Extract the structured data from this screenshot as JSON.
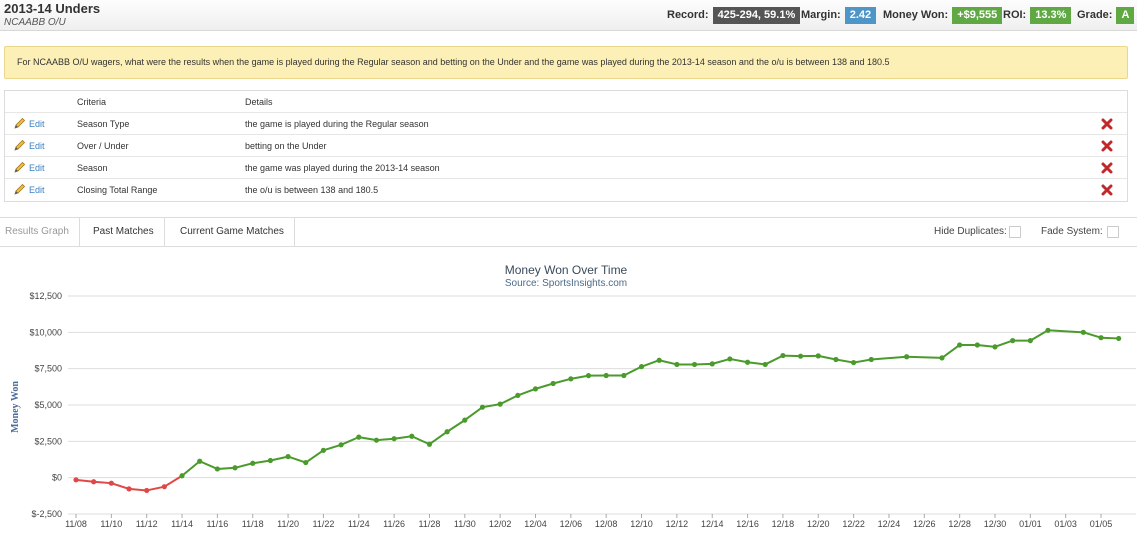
{
  "header": {
    "title": "2013-14 Unders",
    "subtitle": "NCAABB O/U",
    "record_label": "Record:",
    "record_value": "425-294, 59.1%",
    "margin_label": "Margin:",
    "margin_value": "2.42",
    "money_label": "Money Won:",
    "money_value": "+$9,555",
    "roi_label": "ROI:",
    "roi_value": "13.3%",
    "grade_label": "Grade:",
    "grade_value": "A"
  },
  "alert": {
    "text": "For NCAABB O/U wagers, what were the results when the game is played during the Regular season and betting on the Under and the game was played during the 2013-14 season and the o/u is between 138 and 180.5"
  },
  "criteria": {
    "col_criteria": "Criteria",
    "col_details": "Details",
    "edit_label": "Edit",
    "rows": [
      {
        "criteria": "Season Type",
        "details": "the game is played during the Regular season"
      },
      {
        "criteria": "Over / Under",
        "details": "betting on the Under"
      },
      {
        "criteria": "Season",
        "details": "the game was played during the 2013-14 season"
      },
      {
        "criteria": "Closing Total Range",
        "details": "the o/u is between 138 and 180.5"
      }
    ]
  },
  "tabs": {
    "results_graph": "Results Graph",
    "past_matches": "Past Matches",
    "current_game_matches": "Current Game Matches",
    "hide_duplicates": "Hide Duplicates:",
    "fade_system": "Fade System:"
  },
  "colors": {
    "positive": "#4a9a2c",
    "negative": "#e04848",
    "grid": "#dddddd"
  },
  "chart_data": {
    "type": "line",
    "title": "Money Won Over Time",
    "subtitle": "Source: SportsInsights.com",
    "ylabel": "Money Won",
    "xlabel": "",
    "ylim": [
      -2500,
      12500
    ],
    "yticks": [
      -2500,
      0,
      2500,
      5000,
      7500,
      10000,
      12500
    ],
    "ytick_labels": [
      "$-2,500",
      "$0",
      "$2,500",
      "$5,000",
      "$7,500",
      "$10,000",
      "$12,500"
    ],
    "xticks": [
      "11/08",
      "11/10",
      "11/12",
      "11/14",
      "11/16",
      "11/18",
      "11/20",
      "11/22",
      "11/24",
      "11/26",
      "11/28",
      "11/30",
      "12/02",
      "12/04",
      "12/06",
      "12/08",
      "12/10",
      "12/12",
      "12/14",
      "12/16",
      "12/18",
      "12/20",
      "12/22",
      "12/24",
      "12/26",
      "12/28",
      "12/30",
      "01/01",
      "01/03",
      "01/05"
    ],
    "series": [
      {
        "x": [
          "2013-11-08",
          "2013-11-09",
          "2013-11-10",
          "2013-11-11",
          "2013-11-12",
          "2013-11-13",
          "2013-11-14",
          "2013-11-15",
          "2013-11-16",
          "2013-11-17",
          "2013-11-18",
          "2013-11-19",
          "2013-11-20",
          "2013-11-21",
          "2013-11-22",
          "2013-11-23",
          "2013-11-24",
          "2013-11-25",
          "2013-11-26",
          "2013-11-27",
          "2013-11-28",
          "2013-11-29",
          "2013-11-30",
          "2013-12-01",
          "2013-12-02",
          "2013-12-03",
          "2013-12-04",
          "2013-12-05",
          "2013-12-06",
          "2013-12-07",
          "2013-12-08",
          "2013-12-09",
          "2013-12-10",
          "2013-12-11",
          "2013-12-12",
          "2013-12-13",
          "2013-12-14",
          "2013-12-15",
          "2013-12-16",
          "2013-12-17",
          "2013-12-18",
          "2013-12-19",
          "2013-12-20",
          "2013-12-21",
          "2013-12-22",
          "2013-12-23",
          "2013-12-25",
          "2013-12-27",
          "2013-12-28",
          "2013-12-29",
          "2013-12-30",
          "2013-12-31",
          "2014-01-01",
          "2014-01-02",
          "2014-01-04",
          "2014-01-05",
          "2014-01-06"
        ],
        "values": [
          -150,
          -280,
          -380,
          -770,
          -880,
          -620,
          130,
          1130,
          600,
          680,
          990,
          1180,
          1450,
          1040,
          1880,
          2260,
          2790,
          2580,
          2680,
          2850,
          2300,
          3160,
          3960,
          4850,
          5060,
          5660,
          6110,
          6480,
          6800,
          7020,
          7030,
          7030,
          7640,
          8080,
          7790,
          7790,
          7830,
          8170,
          7940,
          7790,
          8400,
          8360,
          8380,
          8130,
          7920,
          8130,
          8320,
          8240,
          9130,
          9130,
          9000,
          9430,
          9430,
          10140,
          10000,
          9630,
          9580
        ]
      }
    ]
  }
}
